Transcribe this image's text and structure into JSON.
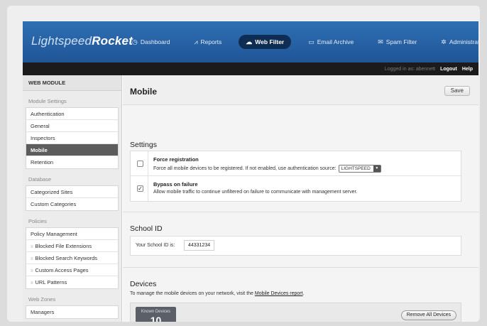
{
  "brand": {
    "part1": "Lightspeed",
    "part2": "Rocket"
  },
  "nav": [
    {
      "label": "Dashboard",
      "icon": "◷",
      "active": false
    },
    {
      "label": "Reports",
      "icon": "⩘",
      "active": false
    },
    {
      "label": "Web Filter",
      "icon": "☁",
      "active": true
    },
    {
      "label": "Email Archive",
      "icon": "▭",
      "active": false
    },
    {
      "label": "Spam Filter",
      "icon": "✉",
      "active": false
    },
    {
      "label": "Administration",
      "icon": "✲",
      "active": false
    }
  ],
  "subbar": {
    "user": "Logged in as: abennett",
    "logout": "Logout",
    "help": "Help"
  },
  "sidebar": {
    "title": "WEB MODULE",
    "sections": [
      {
        "label": "Module Settings",
        "items": [
          "Authentication",
          "General",
          "Inspectors",
          "Mobile",
          "Retention"
        ],
        "active": "Mobile"
      },
      {
        "label": "Database",
        "items": [
          "Categorized Sites",
          "Custom Categories"
        ]
      },
      {
        "label": "Policies",
        "items": [
          "Policy Management",
          "Blocked File Extensions",
          "Blocked Search Keywords",
          "Custom Access Pages",
          "URL Patterns"
        ]
      },
      {
        "label": "Web Zones",
        "items": [
          "Managers"
        ]
      }
    ]
  },
  "page": {
    "title": "Mobile",
    "save": "Save"
  },
  "settings": {
    "title": "Settings",
    "force": {
      "name": "Force registration",
      "desc": "Force all mobile devices to be registered. If not enabled, use authentication source:",
      "select": "LIGHTSPEED",
      "checked": false
    },
    "bypass": {
      "name": "Bypass on failure",
      "desc": "Allow mobile traffic to continue unfiltered on failure to communicate with management server.",
      "checked": true
    }
  },
  "school": {
    "title": "School ID",
    "label": "Your School ID is:",
    "value": "44331234"
  },
  "devices": {
    "title": "Devices",
    "desc": "To manage the mobile devices on your network, visit the",
    "link": "Mobile Devices report",
    "period": ".",
    "known_label": "Known Devices",
    "known_count": "10",
    "remove": "Remove All Devices"
  },
  "icons": {
    "check": "✓",
    "dropdown": "▼",
    "bullet": "≡"
  }
}
